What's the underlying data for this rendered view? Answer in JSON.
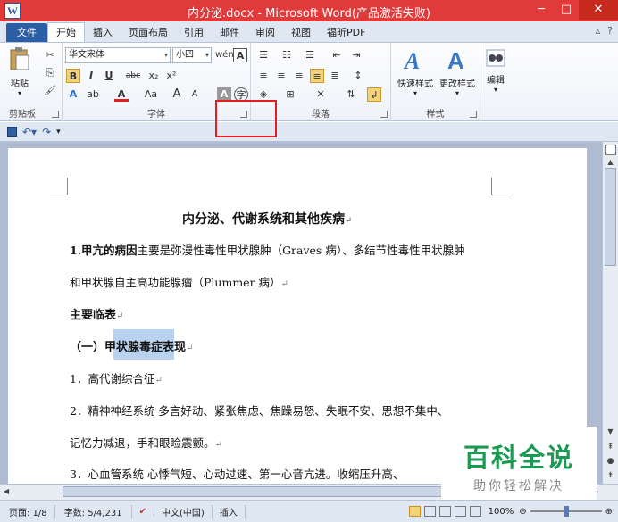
{
  "window": {
    "title": "内分泌.docx - Microsoft Word(产品激活失败)",
    "app_icon": "W",
    "minimize": "─",
    "maximize": "□",
    "close": "✕"
  },
  "tabs": {
    "file": "文件",
    "items": [
      "开始",
      "插入",
      "页面布局",
      "引用",
      "邮件",
      "审阅",
      "视图",
      "福昕PDF"
    ],
    "active": "开始"
  },
  "ribbon": {
    "clipboard": {
      "paste": "粘贴",
      "label": "剪贴板"
    },
    "font": {
      "name": "华文宋体",
      "size": "小四",
      "label": "字体",
      "bold": "B",
      "italic": "I",
      "underline": "U",
      "strike": "abc",
      "subscript": "x₂",
      "superscript": "x²",
      "case": "Aa",
      "grow": "A",
      "shrink": "A"
    },
    "paragraph": {
      "label": "段落"
    },
    "styles": {
      "quick": "快速样式",
      "change": "更改样式",
      "label": "样式"
    },
    "editing": {
      "label": "编辑"
    }
  },
  "document": {
    "title": "内分泌、代谢系统和其他疾病",
    "p1_bold": "1.甲亢的病因",
    "p1_text": "主要是弥漫性毒性甲状腺肿（Graves 病）、多结节性毒性甲状腺肿",
    "p2": "和甲状腺自主高功能腺瘤（Plummer 病）",
    "heading1": "主要临表",
    "heading2_prefix": "（一）",
    "heading2_hl": "甲状腺毒症",
    "heading2_suffix": "表现",
    "item1": "1．高代谢综合征",
    "item2": "2．精神神经系统   多言好动、紧张焦虑、焦躁易怒、失眠不安、思想不集中、",
    "item2b": "记忆力减退，手和眼睑震颤。",
    "item3": "3．心血管系统   心悸气短、心动过速、第一心音亢进。收缩压升高、"
  },
  "status": {
    "page": "页面: 1/8",
    "words": "字数: 5/4,231",
    "language": "中文(中国)",
    "mode": "插入",
    "zoom": "100%"
  },
  "watermark": {
    "line1": "百科全说",
    "line2": "助你轻松解决"
  }
}
